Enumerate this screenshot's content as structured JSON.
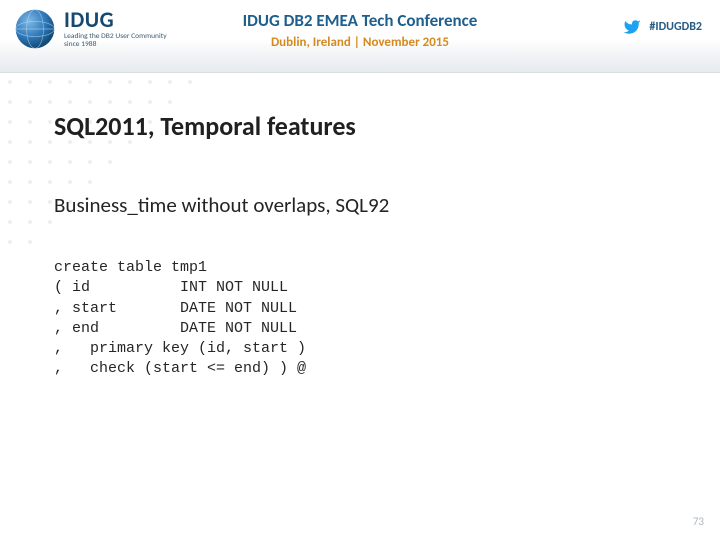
{
  "header": {
    "brand": "IDUG",
    "tagline": "Leading the DB2 User Community since 1988",
    "conference_title": "IDUG DB2 EMEA Tech Conference",
    "conference_subtitle": "Dublin, Ireland | November 2015",
    "hashtag": "#IDUGDB2"
  },
  "slide": {
    "title": "SQL2011, Temporal features",
    "subheading": "Business_time without overlaps, SQL92",
    "code": "create table tmp1\n( id          INT NOT NULL\n, start       DATE NOT NULL\n, end         DATE NOT NULL\n,   primary key (id, start )\n,   check (start <= end) ) @"
  },
  "page_number": "73"
}
